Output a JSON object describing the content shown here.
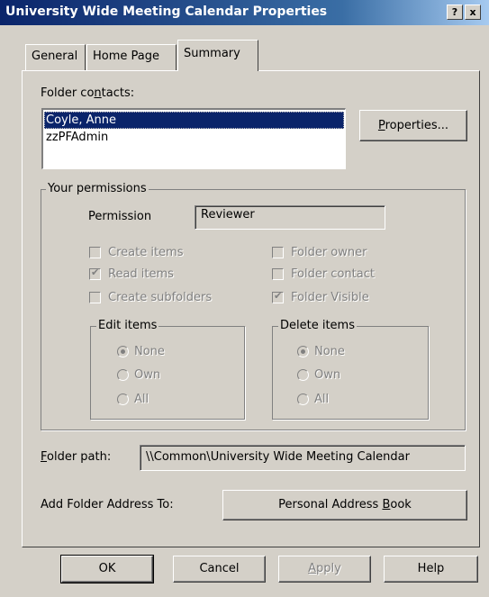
{
  "window": {
    "title": "University Wide Meeting Calendar Properties",
    "help_button": "?",
    "close_button": "x"
  },
  "tabs": [
    {
      "label": "General",
      "active": false
    },
    {
      "label": "Home Page",
      "active": false
    },
    {
      "label": "Summary",
      "active": true
    }
  ],
  "contacts": {
    "label_prefix": "Folder co",
    "label_underlined": "n",
    "label_suffix": "tacts:",
    "items": [
      {
        "name": "Coyle, Anne",
        "selected": true
      },
      {
        "name": "zzPFAdmin",
        "selected": false
      }
    ],
    "properties_button_underlined": "P",
    "properties_button_rest": "roperties..."
  },
  "permissions": {
    "group_label": "Your permissions",
    "permission_label": "Permission",
    "permission_value": "Reviewer",
    "checkboxes": [
      {
        "label": "Create items",
        "checked": false
      },
      {
        "label": "Read items",
        "checked": true
      },
      {
        "label": "Create subfolders",
        "checked": false
      },
      {
        "label": "Folder owner",
        "checked": false
      },
      {
        "label": "Folder contact",
        "checked": false
      },
      {
        "label": "Folder Visible",
        "checked": true
      }
    ],
    "edit_items": {
      "label": "Edit items",
      "options": [
        {
          "label": "None",
          "selected": true
        },
        {
          "label": "Own",
          "selected": false
        },
        {
          "label": "All",
          "selected": false
        }
      ]
    },
    "delete_items": {
      "label": "Delete items",
      "options": [
        {
          "label": "None",
          "selected": true
        },
        {
          "label": "Own",
          "selected": false
        },
        {
          "label": "All",
          "selected": false
        }
      ]
    }
  },
  "folder_path": {
    "label_underlined": "F",
    "label_rest": "older path:",
    "value": "\\\\Common\\University Wide Meeting Calendar"
  },
  "address": {
    "label": "Add Folder Address To:",
    "button_prefix": "Personal Address ",
    "button_underlined": "B",
    "button_suffix": "ook"
  },
  "footer": {
    "ok": "OK",
    "cancel": "Cancel",
    "apply_underlined": "A",
    "apply_rest": "pply",
    "help": "Help"
  }
}
